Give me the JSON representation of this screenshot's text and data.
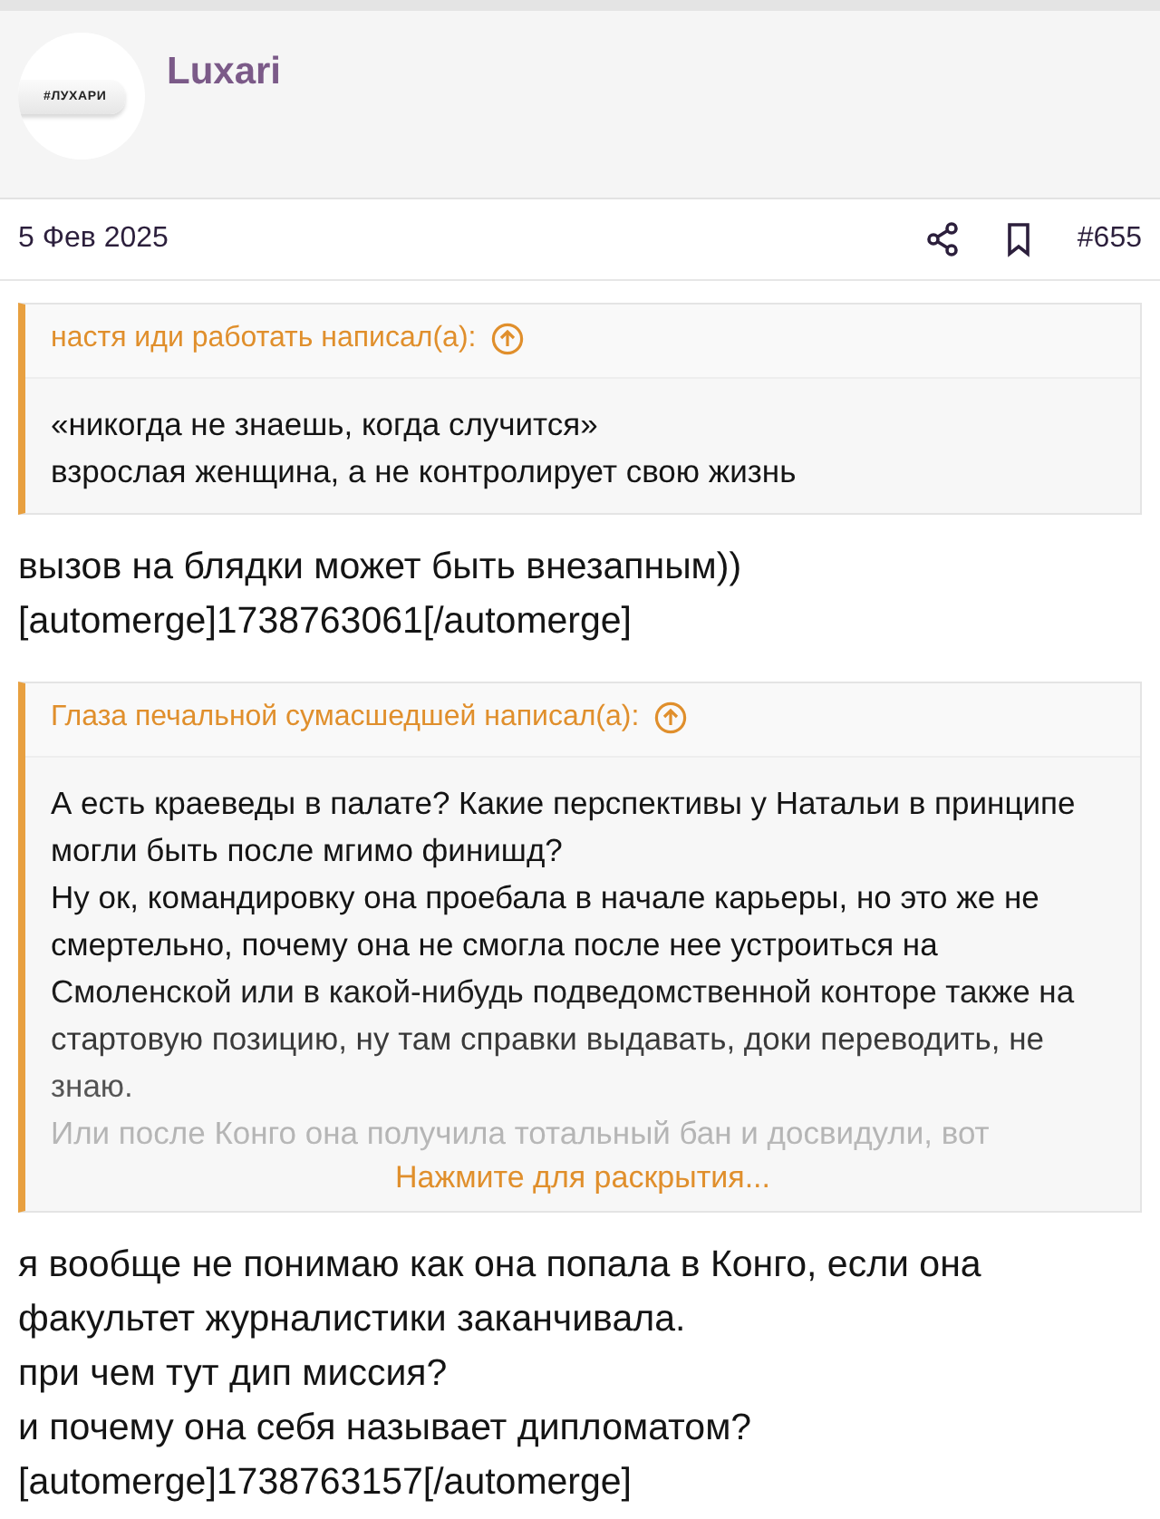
{
  "author": {
    "name": "Luxari",
    "avatar_label": "#ЛУХАРИ"
  },
  "post": {
    "date": "5 Фев 2025",
    "number": "#655"
  },
  "blocks": [
    {
      "kind": "quote",
      "attribution": "настя иди работать написал(а):",
      "lines": [
        "«никогда не знаешь, когда случится»",
        "взрослая женщина, а не контролирует свою жизнь"
      ]
    },
    {
      "kind": "text",
      "lines": [
        "вызов на блядки может быть внезапным))",
        "[automerge]1738763061[/automerge]"
      ]
    },
    {
      "kind": "quote",
      "attribution": "Глаза печальной сумасшедшей написал(а):",
      "lines": [
        "А есть краеведы в палате? Какие перспективы у Натальи в принципе могли быть после мгимо финишд?",
        "Ну ок, командировку она проебала в начале карьеры, но это же не смертельно, почему она не смогла после нее устроиться на Смоленской или в какой-нибудь подведомственной конторе также на стартовую позицию, ну там справки выдавать, доки переводить, не знаю."
      ],
      "faded_lines": [
        "Или после Конго она получила тотальный бан и досвидули, вот"
      ],
      "expand_link": "Нажмите для раскрытия..."
    },
    {
      "kind": "text",
      "lines": [
        "я вообще не понимаю как она попала в Конго, если она факультет журналистики заканчивала.",
        "при чем тут дип миссия?",
        "и почему она себя называет дипломатом?",
        "[automerge]1738763157[/automerge]"
      ]
    }
  ]
}
